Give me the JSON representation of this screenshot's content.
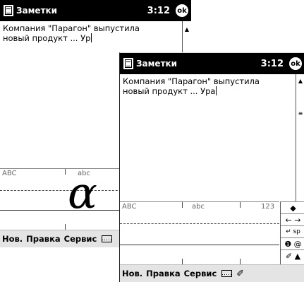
{
  "screen1": {
    "title": "Заметки",
    "time": "3:12",
    "ok_label": "ok",
    "note_lines": [
      "Компания \"Парагон\" выпустила",
      "новый продукт ... Ур"
    ],
    "zone_labels": [
      "ABC",
      "abc"
    ],
    "handwritten_char": "α",
    "menu": [
      "Нов.",
      "Правка",
      "Сервис"
    ]
  },
  "screen2": {
    "title": "Заметки",
    "time": "3:12",
    "ok_label": "ok",
    "note_lines": [
      "Компания \"Парагон\" выпустила",
      "новый продукт ... Ура"
    ],
    "zone_labels": [
      "ABC",
      "abc",
      "123"
    ],
    "side_buttons": [
      "◆",
      "← →",
      "↵ sp",
      "❶ @",
      "✐ ▲"
    ],
    "menu": [
      "Нов.",
      "Правка",
      "Сервис"
    ]
  },
  "icons": {
    "app_icon": "notes-icon",
    "keyboard_icon": "keyboard-icon",
    "pen_icon": "pen-icon"
  }
}
